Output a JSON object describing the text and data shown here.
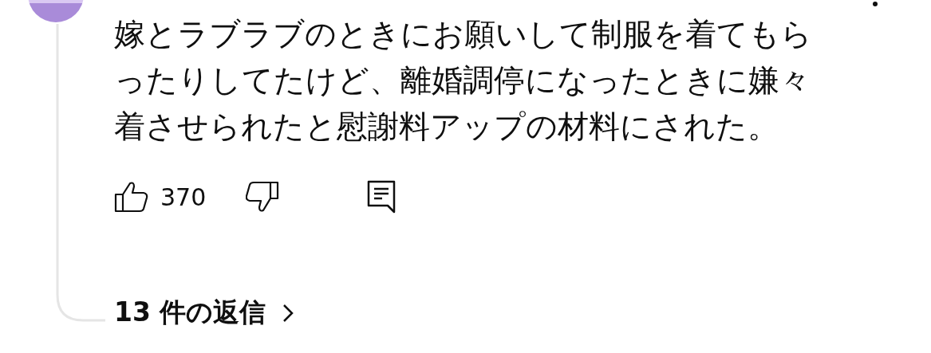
{
  "comment": {
    "text": "嫁とラブラブのときにお願いして制服を着てもらったりしてたけど、離婚調停になったときに嫌々着させられたと慰謝料アップの材料にされた。"
  },
  "actions": {
    "like_count": "370"
  },
  "replies": {
    "label": "13 件の返信"
  }
}
